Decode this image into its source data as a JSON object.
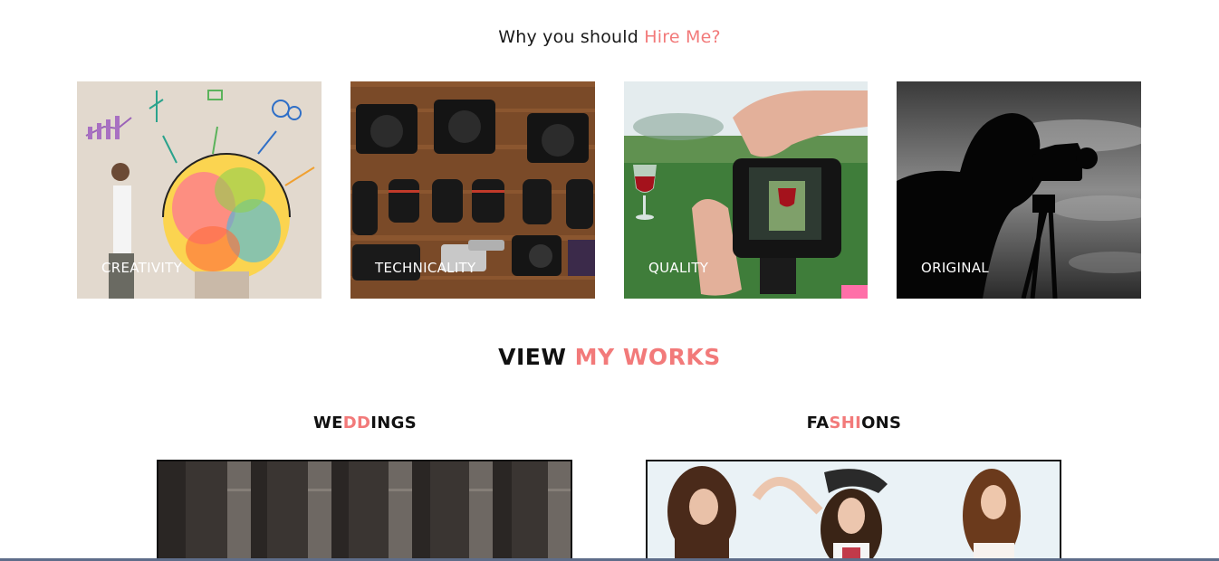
{
  "hire": {
    "title_prefix": "Why you should ",
    "title_accent": "Hire Me?"
  },
  "features": [
    {
      "label": "CREATIVITY"
    },
    {
      "label": "TECHNICALITY"
    },
    {
      "label": "QUALITY"
    },
    {
      "label": "ORIGINAL"
    }
  ],
  "works": {
    "title_prefix": "VIEW ",
    "title_accent": "MY WORKS"
  },
  "categories": {
    "weddings": {
      "part1": "WE",
      "part2": "DD",
      "part3": "INGS"
    },
    "fashions": {
      "part1": "FA",
      "part2": "SHI",
      "part3": "ONS"
    }
  },
  "colors": {
    "accent": "#f27a7a",
    "text": "#111111"
  }
}
